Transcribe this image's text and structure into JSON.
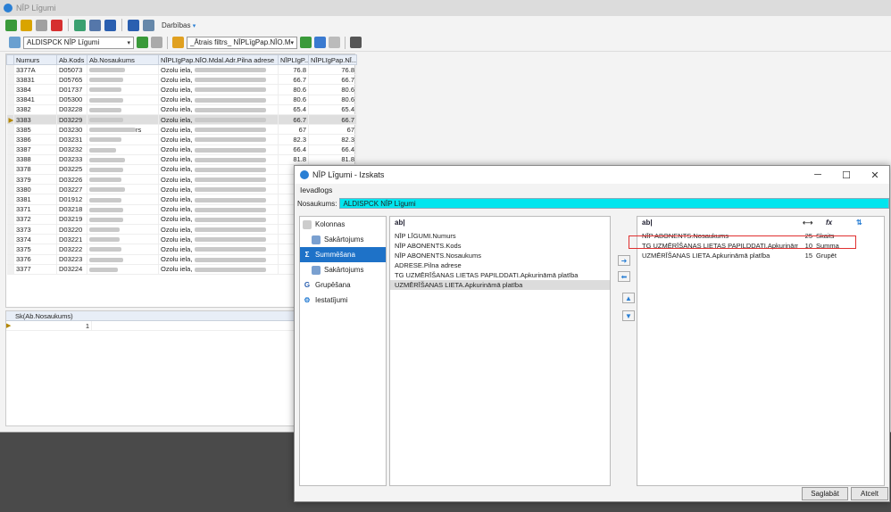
{
  "main_window": {
    "title": "NĪP Līgumi",
    "toolbar": {
      "actions_label": "Darbības"
    },
    "view_combo": "ALDISPCK NĪP Līgumi",
    "filter_combo": "_Ātrais filtrs_ NĪPLīgPap.NĪO.Mdal.A"
  },
  "grid": {
    "columns": [
      "Numurs",
      "Ab.Kods",
      "Ab.Nosaukums",
      "NĪPLīgPap.NĪO.Mdal.Adr.Pilna adrese",
      "NĪPLīgP...",
      "NĪPLīgPap.NĪ..."
    ],
    "rows": [
      [
        "3377A",
        "D05073",
        "Ozolu iela,",
        "76.8",
        "76.8"
      ],
      [
        "33831",
        "D05765",
        "Ozolu iela,",
        "66.7",
        "66.7"
      ],
      [
        "3384",
        "D01737",
        "Ozolu iela,",
        "80.6",
        "80.6"
      ],
      [
        "33841",
        "D05300",
        "Ozolu iela,",
        "80.6",
        "80.6"
      ],
      [
        "3382",
        "D03228",
        "Ozolu iela,",
        "65.4",
        "65.4"
      ],
      [
        "3383",
        "D03229",
        "Ozolu iela,",
        "66.7",
        "66.7"
      ],
      [
        "3385",
        "D03230",
        "Ozolu iela,",
        "67",
        "67"
      ],
      [
        "3386",
        "D03231",
        "Ozolu iela,",
        "82.3",
        "82.3"
      ],
      [
        "3387",
        "D03232",
        "Ozolu iela,",
        "66.4",
        "66.4"
      ],
      [
        "3388",
        "D03233",
        "Ozolu iela,",
        "81.8",
        "81.8"
      ],
      [
        "3378",
        "D03225",
        "Ozolu iela,",
        "",
        ""
      ],
      [
        "3379",
        "D03226",
        "Ozolu iela,",
        "",
        ""
      ],
      [
        "3380",
        "D03227",
        "Ozolu iela,",
        "",
        ""
      ],
      [
        "3381",
        "D01912",
        "Ozolu iela,",
        "",
        ""
      ],
      [
        "3371",
        "D03218",
        "Ozolu iela,",
        "",
        ""
      ],
      [
        "3372",
        "D03219",
        "Ozolu iela,",
        "",
        ""
      ],
      [
        "3373",
        "D03220",
        "Ozolu iela,",
        "",
        ""
      ],
      [
        "3374",
        "D03221",
        "Ozolu iela,",
        "",
        ""
      ],
      [
        "3375",
        "D03222",
        "Ozolu iela,",
        "",
        ""
      ],
      [
        "3376",
        "D03223",
        "Ozolu iela,",
        "",
        ""
      ],
      [
        "3377",
        "D03224",
        "Ozolu iela,",
        "",
        ""
      ]
    ],
    "selected_row": 5,
    "row7_suffix": "rs"
  },
  "summary": {
    "header": "Sk(Ab.Nosaukums)",
    "value": "1"
  },
  "dialog": {
    "title": "NĪP Līgumi - Izskats",
    "section": "Ievadlogs",
    "name_label": "Nosaukums:",
    "name_value": "ALDISPCK NĪP Līgumi",
    "nav": [
      {
        "label": "Kolonnas",
        "icon": "columns-icon"
      },
      {
        "label": "Sakārtojums",
        "icon": "sort-icon"
      },
      {
        "label": "Summēšana",
        "icon": "sum-icon"
      },
      {
        "label": "Sakārtojums",
        "icon": "sort-icon"
      },
      {
        "label": "Grupēšana",
        "icon": "group-icon"
      },
      {
        "label": "Iestatījumi",
        "icon": "settings-icon"
      }
    ],
    "available_header": "ab|",
    "available": [
      "NĪP LĪGUMI.Numurs",
      "NĪP ABONENTS.Kods",
      "NĪP ABONENTS.Nosaukums",
      "ADRESE.Pilna adrese",
      "TG UZMĒRĪŠANAS LIETAS PAPILDDATI.Apkurināmā platība",
      "UZMĒRĪŠANAS LIETA.Apkurināmā platība"
    ],
    "selected_header": "ab|",
    "selected_fn_header": "fx",
    "selected": [
      {
        "field": "NĪP ABONENTS.Nosaukums",
        "width": "25",
        "fn": "Skaits"
      },
      {
        "field": "TG UZMĒRĪŠANAS LIETAS PAPILDDATI.Apkurināmā platība",
        "width": "10",
        "fn": "Summa"
      },
      {
        "field": "UZMĒRĪŠANAS LIETA.Apkurināmā platība",
        "width": "15",
        "fn": "Grupēt"
      }
    ],
    "save_label": "Saglabāt",
    "cancel_label": "Atcelt"
  }
}
